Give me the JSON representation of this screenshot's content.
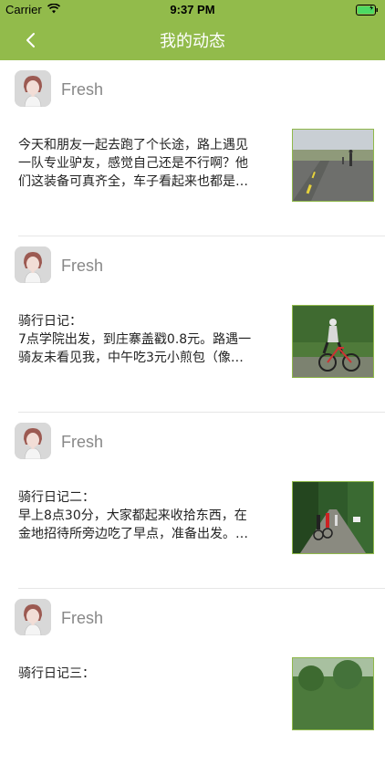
{
  "status_bar": {
    "carrier": "Carrier",
    "time": "9:37 PM",
    "wifi_icon": "wifi-icon",
    "battery_icon": "battery-icon"
  },
  "nav": {
    "title": "我的动态",
    "back_icon": "chevron-left-icon"
  },
  "colors": {
    "accent": "#92bb4b",
    "thumb_border": "#8fb84a",
    "username": "#888888",
    "body_text": "#222222"
  },
  "posts": [
    {
      "username": "Fresh",
      "lines": [
        "今天和朋友一起去跑了个长途，路上遇见",
        "一队专业驴友，感觉自己还是不行啊？他",
        "们这装备可真齐全，车子看起来也都是…"
      ]
    },
    {
      "username": "Fresh",
      "lines": [
        "骑行日记：",
        "7点学院出发，到庄寨盖戳0.8元。路遇一",
        "骑友未看见我，中午吃3元小煎包（像…"
      ]
    },
    {
      "username": "Fresh",
      "lines": [
        "骑行日记二：",
        "早上8点30分，大家都起来收拾东西，在",
        "金地招待所旁边吃了早点，准备出发。…"
      ]
    },
    {
      "username": "Fresh",
      "lines": [
        "骑行日记三：",
        "",
        ""
      ]
    }
  ]
}
